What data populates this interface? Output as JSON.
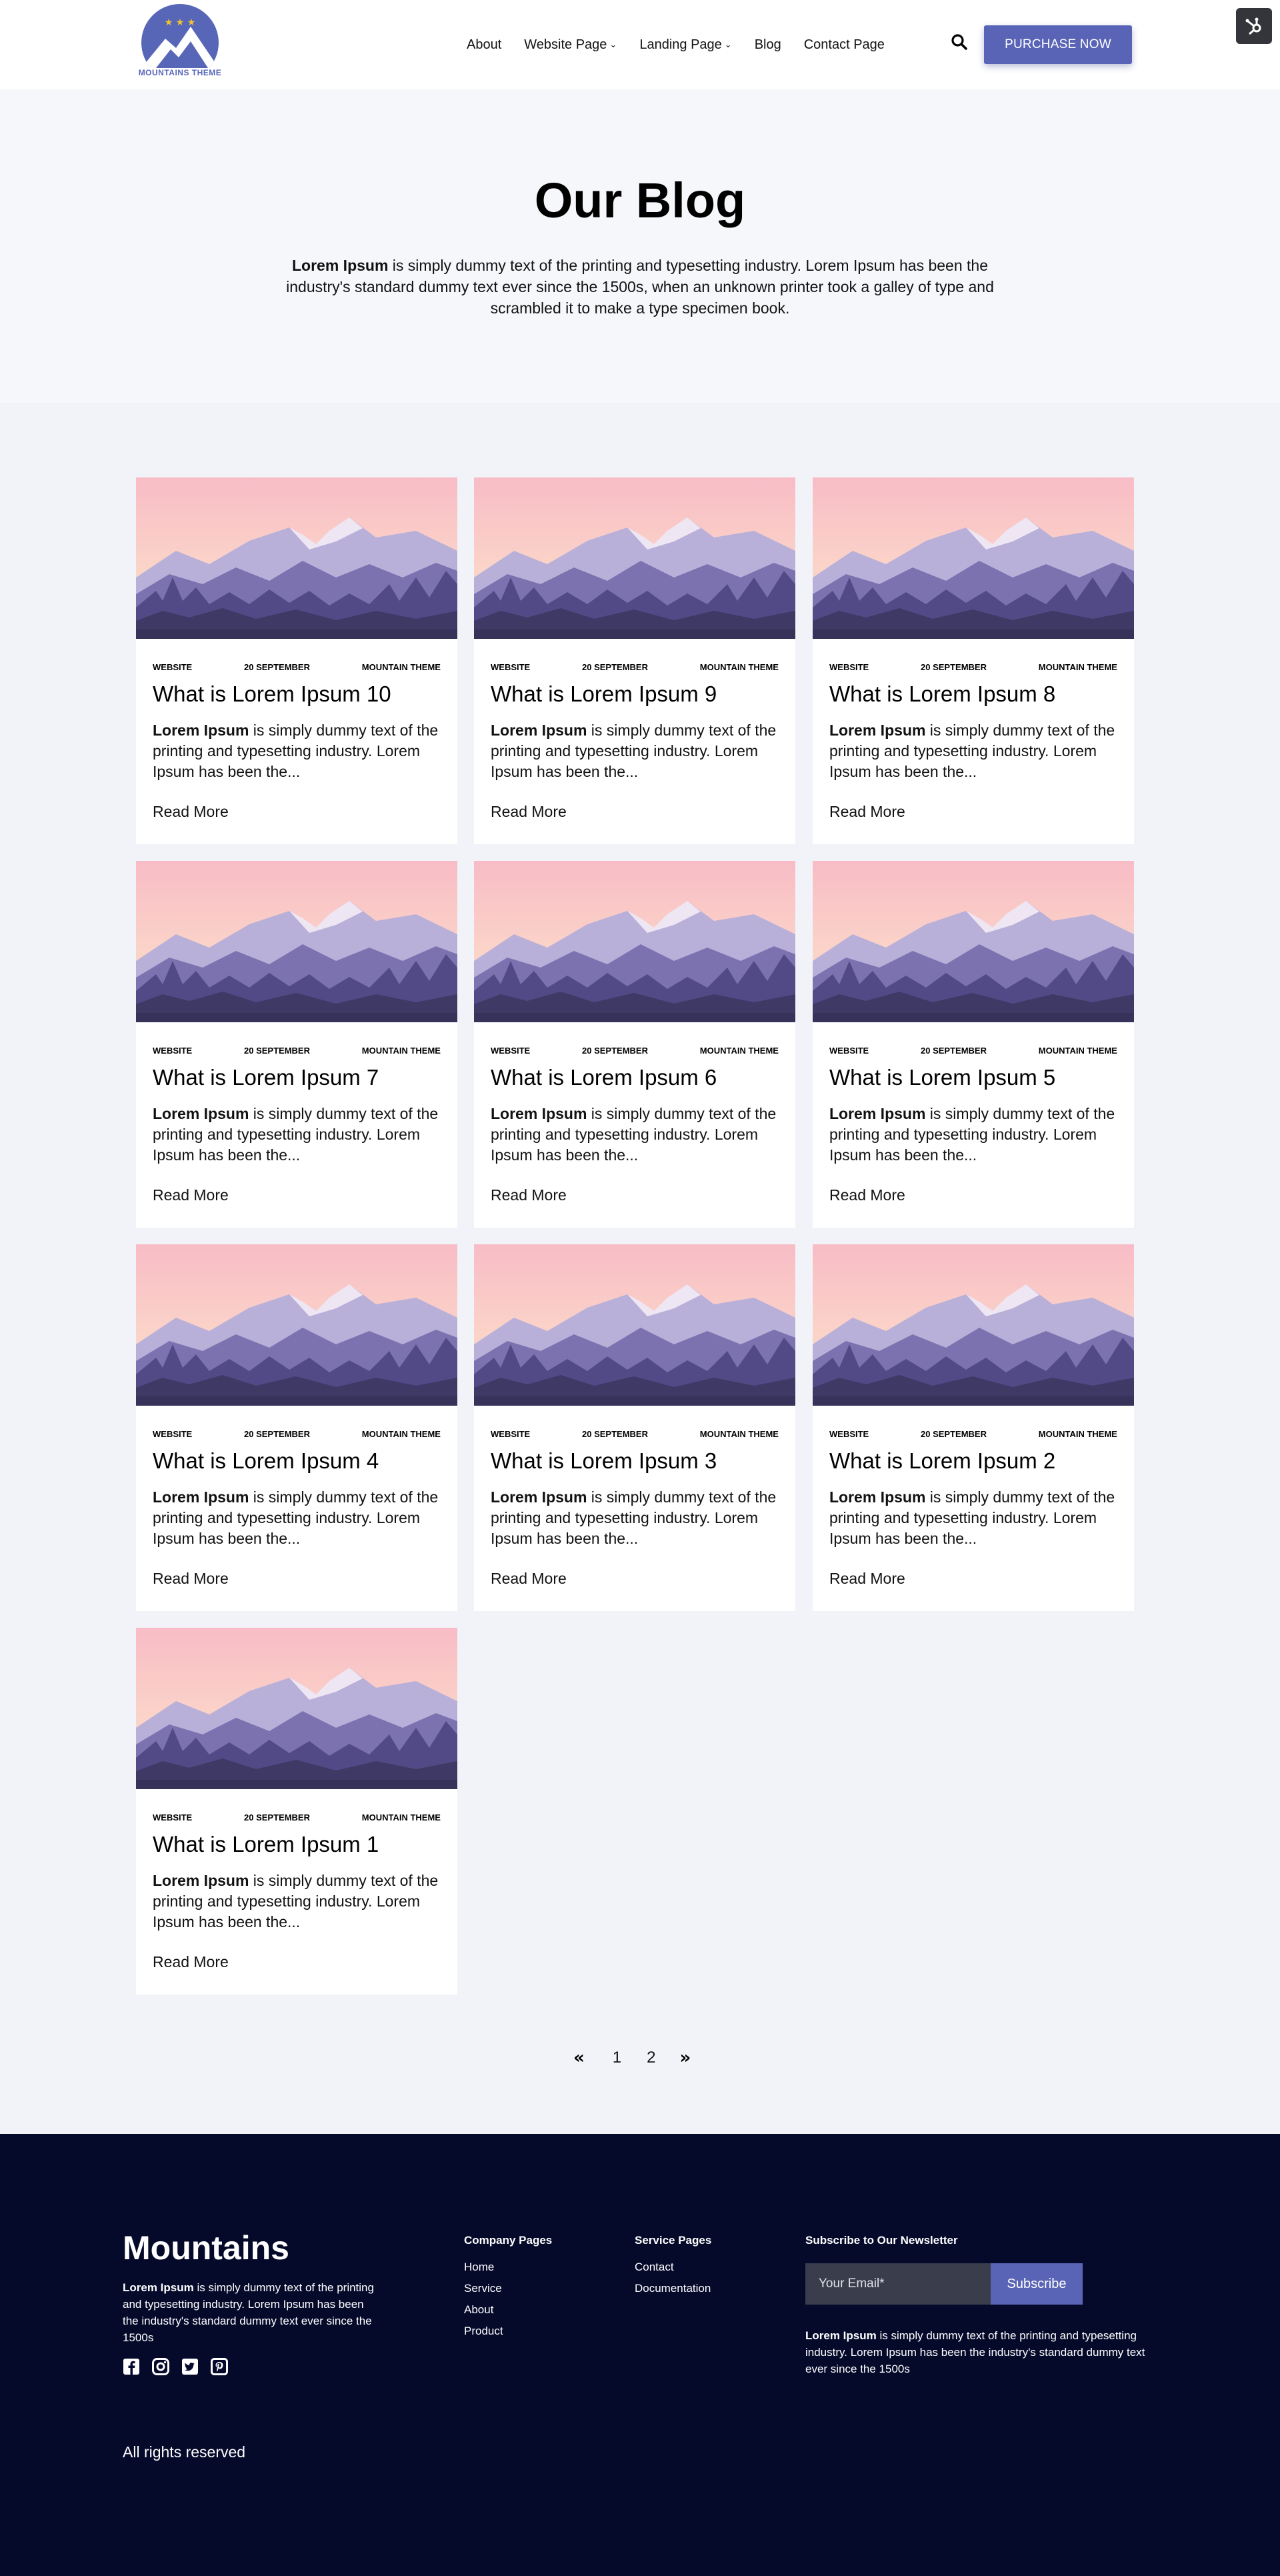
{
  "header": {
    "logo_text": "MOUNTAINS THEME",
    "nav": [
      {
        "label": "About",
        "dropdown": false
      },
      {
        "label": "Website Page",
        "dropdown": true
      },
      {
        "label": "Landing Page",
        "dropdown": true
      },
      {
        "label": "Blog",
        "dropdown": false
      },
      {
        "label": "Contact Page",
        "dropdown": false
      }
    ],
    "purchase_label": "PURCHASE NOW"
  },
  "hero": {
    "title": "Our Blog",
    "desc_bold": "Lorem Ipsum",
    "desc_rest": " is simply dummy text of the printing and typesetting industry. Lorem Ipsum has been the industry's standard dummy text ever since the 1500s, when an unknown printer took a galley of type and scrambled it to make a type specimen book."
  },
  "posts": [
    {
      "category": "WEBSITE",
      "date": "20 SEPTEMBER",
      "tag": "MOUNTAIN THEME",
      "title": "What is Lorem Ipsum 10",
      "excerpt_bold": "Lorem Ipsum",
      "excerpt_rest": " is simply dummy text of the printing and typesetting industry. Lorem Ipsum has been the...",
      "read_more": "Read More"
    },
    {
      "category": "WEBSITE",
      "date": "20 SEPTEMBER",
      "tag": "MOUNTAIN THEME",
      "title": "What is Lorem Ipsum 9",
      "excerpt_bold": "Lorem Ipsum",
      "excerpt_rest": " is simply dummy text of the printing and typesetting industry. Lorem Ipsum has been the...",
      "read_more": "Read More"
    },
    {
      "category": "WEBSITE",
      "date": "20 SEPTEMBER",
      "tag": "MOUNTAIN THEME",
      "title": "What is Lorem Ipsum 8",
      "excerpt_bold": "Lorem Ipsum",
      "excerpt_rest": " is simply dummy text of the printing and typesetting industry. Lorem Ipsum has been the...",
      "read_more": "Read More"
    },
    {
      "category": "WEBSITE",
      "date": "20 SEPTEMBER",
      "tag": "MOUNTAIN THEME",
      "title": "What is Lorem Ipsum 7",
      "excerpt_bold": "Lorem Ipsum",
      "excerpt_rest": " is simply dummy text of the printing and typesetting industry. Lorem Ipsum has been the...",
      "read_more": "Read More"
    },
    {
      "category": "WEBSITE",
      "date": "20 SEPTEMBER",
      "tag": "MOUNTAIN THEME",
      "title": "What is Lorem Ipsum 6",
      "excerpt_bold": "Lorem Ipsum",
      "excerpt_rest": " is simply dummy text of the printing and typesetting industry. Lorem Ipsum has been the...",
      "read_more": "Read More"
    },
    {
      "category": "WEBSITE",
      "date": "20 SEPTEMBER",
      "tag": "MOUNTAIN THEME",
      "title": "What is Lorem Ipsum 5",
      "excerpt_bold": "Lorem Ipsum",
      "excerpt_rest": " is simply dummy text of the printing and typesetting industry. Lorem Ipsum has been the...",
      "read_more": "Read More"
    },
    {
      "category": "WEBSITE",
      "date": "20 SEPTEMBER",
      "tag": "MOUNTAIN THEME",
      "title": "What is Lorem Ipsum 4",
      "excerpt_bold": "Lorem Ipsum",
      "excerpt_rest": " is simply dummy text of the printing and typesetting industry. Lorem Ipsum has been the...",
      "read_more": "Read More"
    },
    {
      "category": "WEBSITE",
      "date": "20 SEPTEMBER",
      "tag": "MOUNTAIN THEME",
      "title": "What is Lorem Ipsum 3",
      "excerpt_bold": "Lorem Ipsum",
      "excerpt_rest": " is simply dummy text of the printing and typesetting industry. Lorem Ipsum has been the...",
      "read_more": "Read More"
    },
    {
      "category": "WEBSITE",
      "date": "20 SEPTEMBER",
      "tag": "MOUNTAIN THEME",
      "title": "What is Lorem Ipsum 2",
      "excerpt_bold": "Lorem Ipsum",
      "excerpt_rest": " is simply dummy text of the printing and typesetting industry. Lorem Ipsum has been the...",
      "read_more": "Read More"
    },
    {
      "category": "WEBSITE",
      "date": "20 SEPTEMBER",
      "tag": "MOUNTAIN THEME",
      "title": "What is Lorem Ipsum 1",
      "excerpt_bold": "Lorem Ipsum",
      "excerpt_rest": " is simply dummy text of the printing and typesetting industry. Lorem Ipsum has been the...",
      "read_more": "Read More"
    }
  ],
  "pagination": {
    "prev_icon": "double-chevron-left-icon",
    "pages": [
      "1",
      "2"
    ],
    "next_icon": "double-chevron-right-icon"
  },
  "footer": {
    "brand": "Mountains",
    "about_bold": "Lorem Ipsum",
    "about_rest": " is simply dummy text of the printing and typesetting industry. Lorem Ipsum has been the industry's standard dummy text ever since the 1500s",
    "socials": [
      "facebook-icon",
      "instagram-icon",
      "twitter-icon",
      "pinterest-icon"
    ],
    "company_title": "Company Pages",
    "company_links": [
      "Home",
      "Service",
      "About",
      "Product"
    ],
    "service_title": "Service Pages",
    "service_links": [
      "Contact",
      "Documentation"
    ],
    "newsletter_title": "Subscribe to Our Newsletter",
    "email_placeholder": "Your Email*",
    "subscribe_label": "Subscribe",
    "newsletter_desc_bold": "Lorem Ipsum",
    "newsletter_desc_rest": " is simply dummy text of the printing and typesetting industry. Lorem Ipsum has been the industry's standard dummy text ever since the 1500s",
    "copyright": "All rights reserved"
  },
  "colors": {
    "accent": "#5964b6",
    "footer_bg": "#050a2b",
    "page_bg": "#f2f3f8"
  }
}
